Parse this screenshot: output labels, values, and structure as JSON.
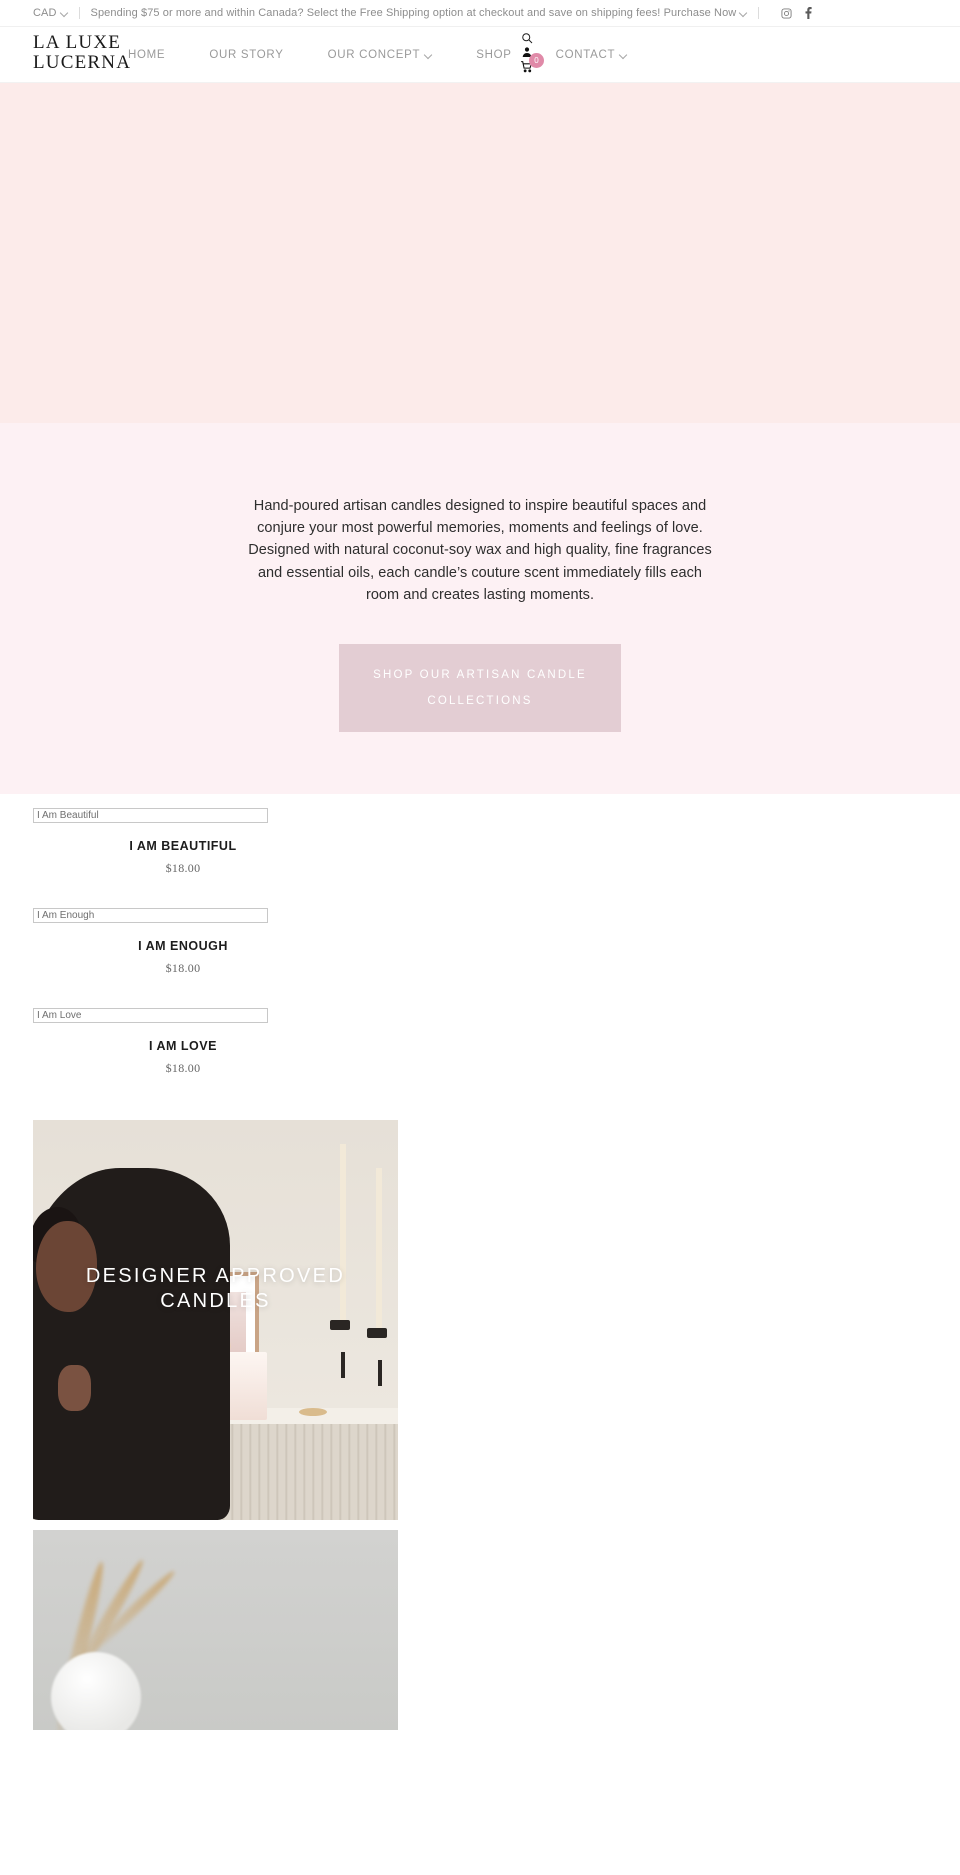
{
  "announcement": {
    "currency": "CAD",
    "currency_caret": "chevron-down-icon",
    "message": "Spending $75 or more and within Canada? Select the Free Shipping option at checkout and save on shipping fees! Purchase Now",
    "message_caret": "chevron-down-icon",
    "social": [
      {
        "name": "instagram-icon",
        "label": "Instagram"
      },
      {
        "name": "facebook-icon",
        "label": "Facebook"
      }
    ]
  },
  "header": {
    "logo_line1": "LA LUXE",
    "logo_line2": "LUCERNA",
    "nav": [
      {
        "label": "HOME",
        "has_caret": false
      },
      {
        "label": "OUR STORY",
        "has_caret": false
      },
      {
        "label": "OUR CONCEPT",
        "has_caret": true
      },
      {
        "label": "SHOP",
        "has_caret": false
      },
      {
        "label": "CONTACT",
        "has_caret": true
      }
    ],
    "icons": {
      "search": "search-icon",
      "account": "account-icon",
      "cart": "cart-icon",
      "cart_count": "0",
      "cart_badge_color": "#e08aa8"
    }
  },
  "hero": {
    "background_color": "#fcebea"
  },
  "intro": {
    "background_color": "#fdf1f4",
    "paragraph": "Hand-poured artisan candles designed to inspire beautiful spaces and conjure your most powerful memories, moments and feelings of love. Designed with natural coconut-soy wax and high quality, fine fragrances and essential oils, each candle’s couture scent immediately fills each room and creates lasting moments.",
    "cta_label": "SHOP OUR ARTISAN CANDLE COLLECTIONS",
    "cta_color": "#e3cdd3"
  },
  "products": [
    {
      "alt_text": "I Am Beautiful",
      "title": "I AM BEAUTIFUL",
      "price": "$18.00"
    },
    {
      "alt_text": "I Am Enough",
      "title": "I AM ENOUGH",
      "price": "$18.00"
    },
    {
      "alt_text": "I Am Love",
      "title": "I AM LOVE",
      "price": "$18.00"
    }
  ],
  "banners": [
    {
      "caption": "DESIGNER APPROVED CANDLES"
    },
    {
      "caption": ""
    }
  ]
}
